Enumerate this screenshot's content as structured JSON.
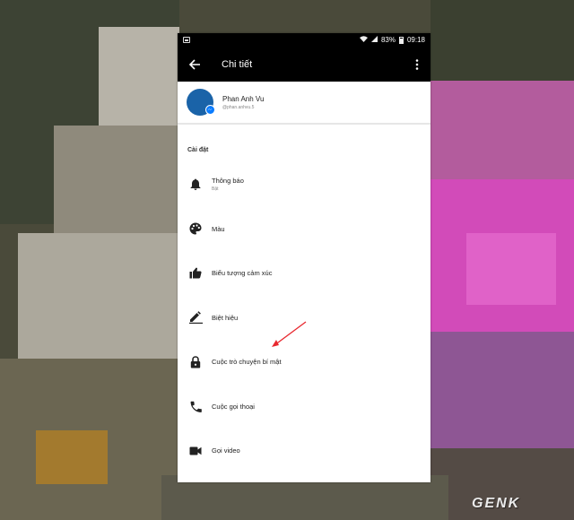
{
  "status_bar": {
    "battery": "83%",
    "time": "09:18"
  },
  "toolbar": {
    "title": "Chi tiết"
  },
  "profile": {
    "name": "Phan Anh Vu",
    "handle": "@phan.anhvu.5"
  },
  "settings": {
    "header": "Cài đặt",
    "items": [
      {
        "label": "Thông báo",
        "sub": "Bật",
        "icon": "bell-icon"
      },
      {
        "label": "Màu",
        "icon": "palette-icon"
      },
      {
        "label": "Biểu tượng cảm xúc",
        "icon": "thumbs-up-icon"
      },
      {
        "label": "Biệt hiệu",
        "icon": "pencil-icon"
      },
      {
        "label": "Cuộc trò chuyện bí mật",
        "icon": "lock-icon"
      },
      {
        "label": "Cuộc gọi thoại",
        "icon": "phone-icon"
      },
      {
        "label": "Gọi video",
        "icon": "video-camera-icon"
      }
    ]
  },
  "watermark": "GENK",
  "colors": {
    "toolbar_bg": "#000000",
    "avatar": "#1a63a8",
    "messenger_badge": "#0a7cff",
    "arrow": "#e8282f"
  }
}
